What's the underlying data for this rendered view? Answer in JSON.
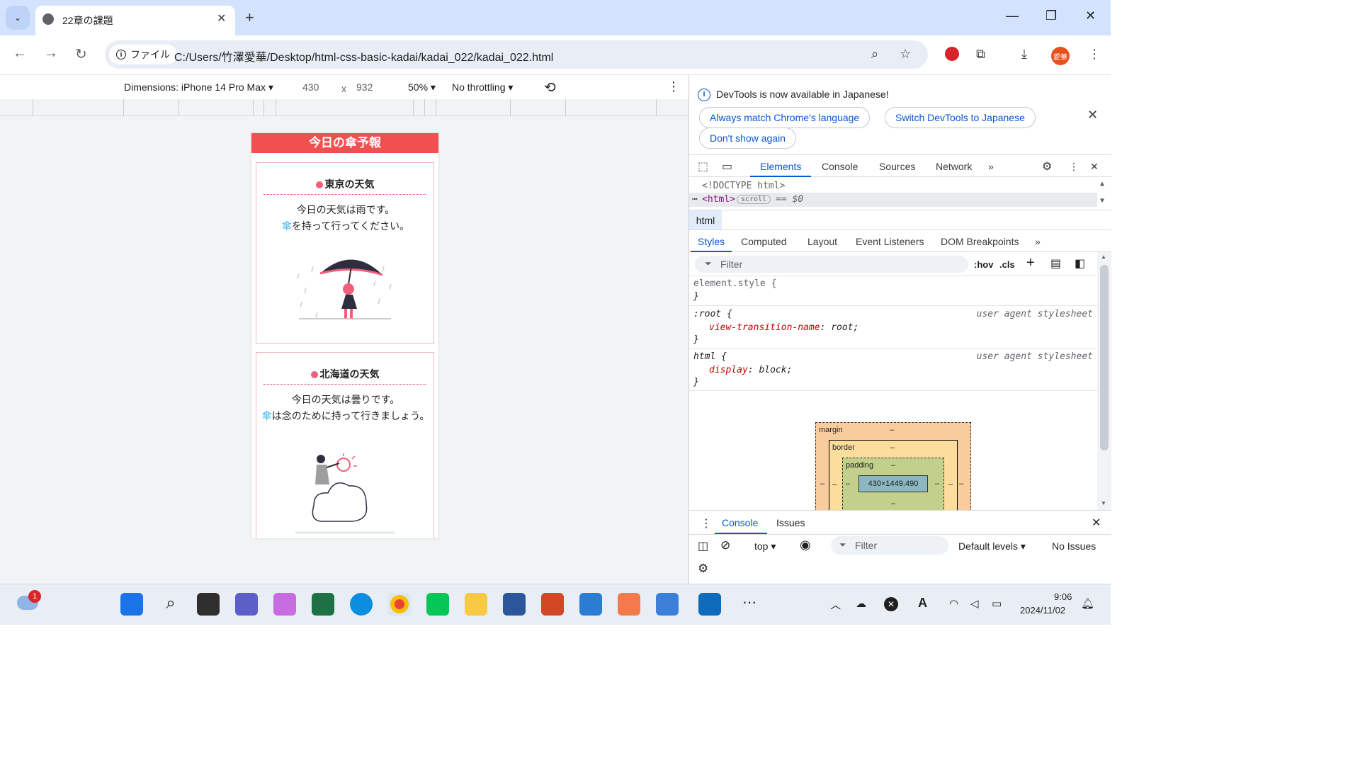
{
  "browser": {
    "tab_title": "22章の課題",
    "chip_label": "ファイル",
    "url": "C:/Users/竹澤愛華/Desktop/html-css-basic-kadai/kadai_022/kadai_022.html",
    "avatar_text": "愛華"
  },
  "device_toolbar": {
    "dimensions": "Dimensions: iPhone 14 Pro Max",
    "width": "430",
    "x": "x",
    "height": "932",
    "zoom": "50%",
    "throttling": "No throttling"
  },
  "page": {
    "header": "今日の傘予報",
    "cards": [
      {
        "title": "東京の天気",
        "line1": "今日の天気は雨です。",
        "umbrella": "傘",
        "line2": "を持って行ってください。"
      },
      {
        "title": "北海道の天気",
        "line1": "今日の天気は曇りです。",
        "umbrella": "傘",
        "line2": "は念のために持って行きましょう。"
      }
    ]
  },
  "devtools": {
    "info_text": "DevTools is now available in Japanese!",
    "btn_match": "Always match Chrome's language",
    "btn_switch": "Switch DevTools to Japanese",
    "btn_dont_show": "Don't show again",
    "tabs": [
      "Elements",
      "Console",
      "Sources",
      "Network"
    ],
    "dom_doctype": "<!DOCTYPE html>",
    "dom_html_tag": "<html>",
    "dom_scroll_badge": "scroll",
    "dom_sel": "== $0",
    "breadcrumb": "html",
    "sub_tabs": [
      "Styles",
      "Computed",
      "Layout",
      "Event Listeners",
      "DOM Breakpoints"
    ],
    "filter_placeholder": "Filter",
    "hov": ":hov",
    "cls": ".cls",
    "rule1_selector": "element.style {",
    "rule_close": "}",
    "rule2_selector": ":root {",
    "rule2_prop": "view-transition-name",
    "rule2_value": " root;",
    "rule3_selector": "html {",
    "rule3_prop": "display",
    "rule3_value": " block;",
    "ua_label": "user agent stylesheet",
    "bm_margin": "margin",
    "bm_border": "border",
    "bm_padding": "padding",
    "bm_dash": "–",
    "bm_content": "430×1449.490",
    "drawer_tabs": [
      "Console",
      "Issues"
    ],
    "drawer_context": "top",
    "drawer_filter": "Filter",
    "drawer_levels": "Default levels",
    "drawer_issues": "No Issues"
  },
  "taskbar": {
    "notification_badge": "1",
    "time": "9:06",
    "date": "2024/11/02"
  },
  "colors": {
    "header_red": "#f05050",
    "accent_blue": "#0b57d0",
    "umbrella_blue": "#38b6e8"
  }
}
